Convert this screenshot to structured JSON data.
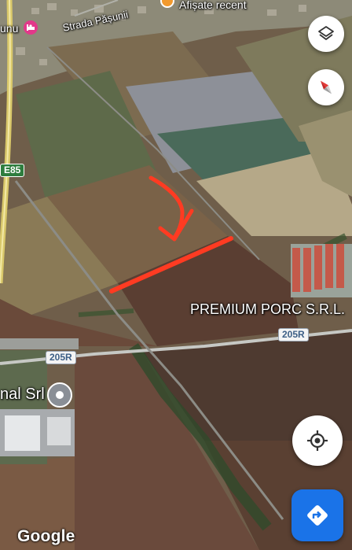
{
  "labels": {
    "recent": "Afișate recent",
    "street": "Strada Pășunii",
    "cut_place": "unu",
    "company_premium": "PREMIUM PORC S.R.L.",
    "company_cut": "nal Srl"
  },
  "roads": {
    "e85": "E85",
    "r205_top": "205R",
    "r205_left": "205R"
  },
  "attribution": "Google",
  "icons": {
    "layers": "layers-icon",
    "compass": "compass-icon",
    "my_location": "my-location-icon",
    "directions": "directions-icon",
    "hotel": "hotel-icon",
    "place": "place-pin-icon",
    "recent": "recent-icon"
  },
  "colors": {
    "annotation": "#ff3b22",
    "directions_button": "#1a73e8",
    "compass_red": "#e53935",
    "hotel_pin": "#e2388a",
    "highway": "#d9c86a"
  }
}
